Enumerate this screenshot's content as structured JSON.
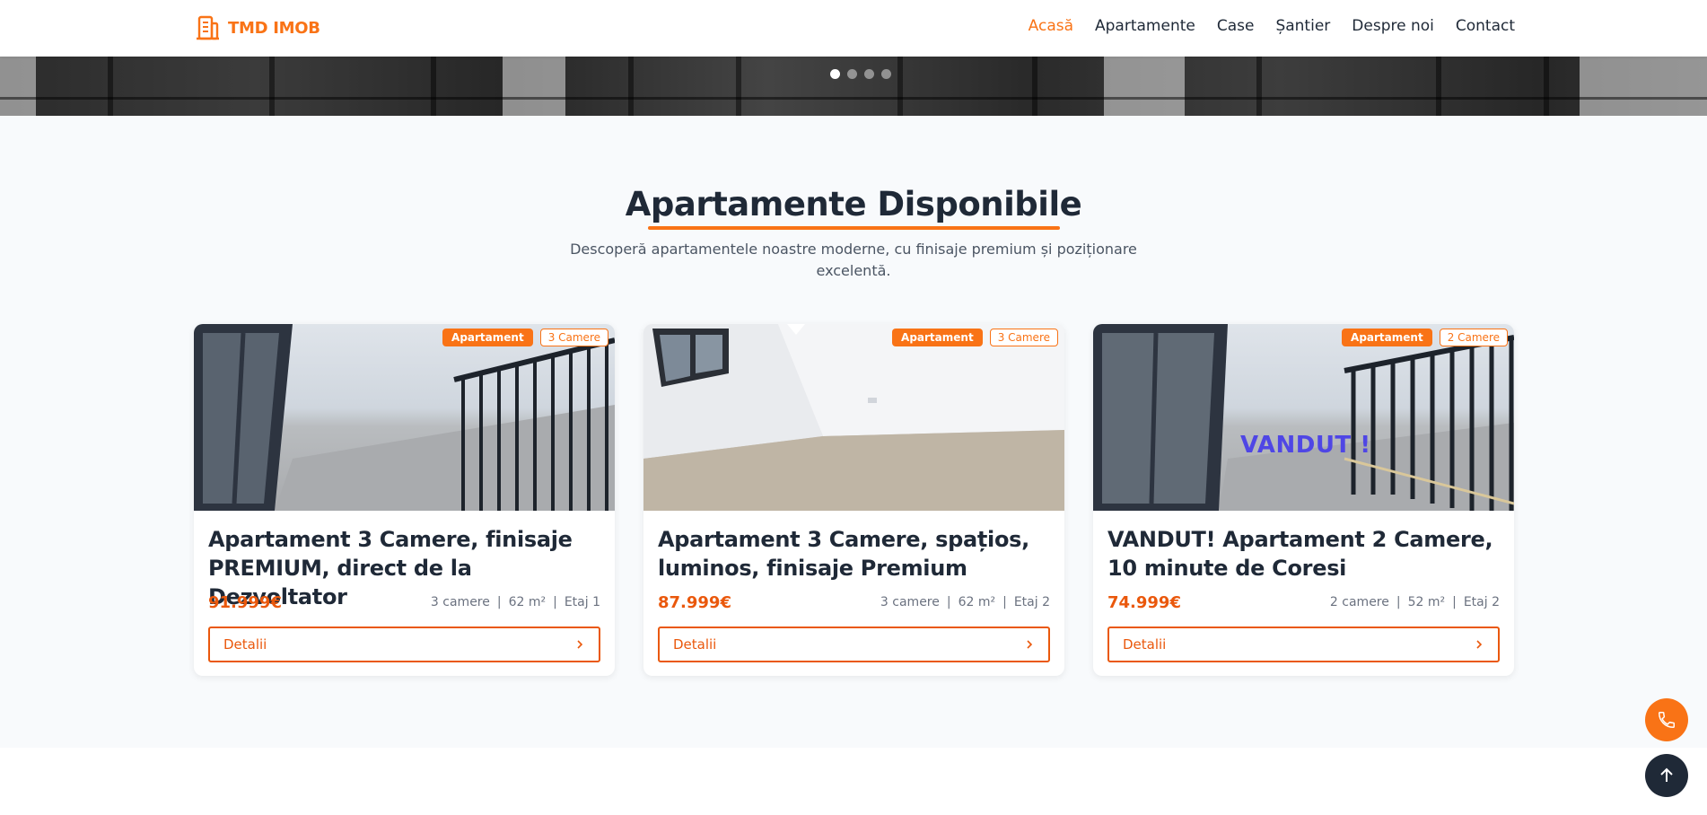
{
  "brand": {
    "name": "TMD IMOB",
    "accent": "#f97316"
  },
  "nav": [
    {
      "label": "Acasă",
      "active": true
    },
    {
      "label": "Apartamente",
      "active": false
    },
    {
      "label": "Case",
      "active": false
    },
    {
      "label": "Șantier",
      "active": false
    },
    {
      "label": "Despre noi",
      "active": false
    },
    {
      "label": "Contact",
      "active": false
    }
  ],
  "hero": {
    "slide_count": 4,
    "active_slide": 1
  },
  "section": {
    "title": "Apartamente Disponibile",
    "subtitle": "Descoperă apartamentele noastre moderne, cu finisaje premium și poziționare excelentă."
  },
  "cards": [
    {
      "type_badge": "Apartament",
      "rooms_badge": "3 Camere",
      "title": "Apartament 3 Camere, finisaje PREMIUM, direct de la Dezvoltator",
      "price": "91.999€",
      "rooms": "3 camere",
      "area": "62 m²",
      "floor": "Etaj 1",
      "button": "Detalii",
      "overlay": ""
    },
    {
      "type_badge": "Apartament",
      "rooms_badge": "3 Camere",
      "title": "Apartament 3 Camere, spațios, luminos, finisaje Premium",
      "price": "87.999€",
      "rooms": "3 camere",
      "area": "62 m²",
      "floor": "Etaj 2",
      "button": "Detalii",
      "overlay": ""
    },
    {
      "type_badge": "Apartament",
      "rooms_badge": "2 Camere",
      "title": "VANDUT! Apartament 2 Camere, 10 minute de Coresi",
      "price": "74.999€",
      "rooms": "2 camere",
      "area": "52 m²",
      "floor": "Etaj 2",
      "button": "Detalii",
      "overlay": "VANDUT !"
    }
  ],
  "icons": {
    "logo": "building-icon",
    "phone": "phone-icon",
    "scroll_top": "arrow-up-icon",
    "chevron": "chevron-right-icon"
  },
  "colors": {
    "accent": "#f97316",
    "price": "#ea580c",
    "dark": "#1f2937",
    "background": "#f8fafc"
  }
}
